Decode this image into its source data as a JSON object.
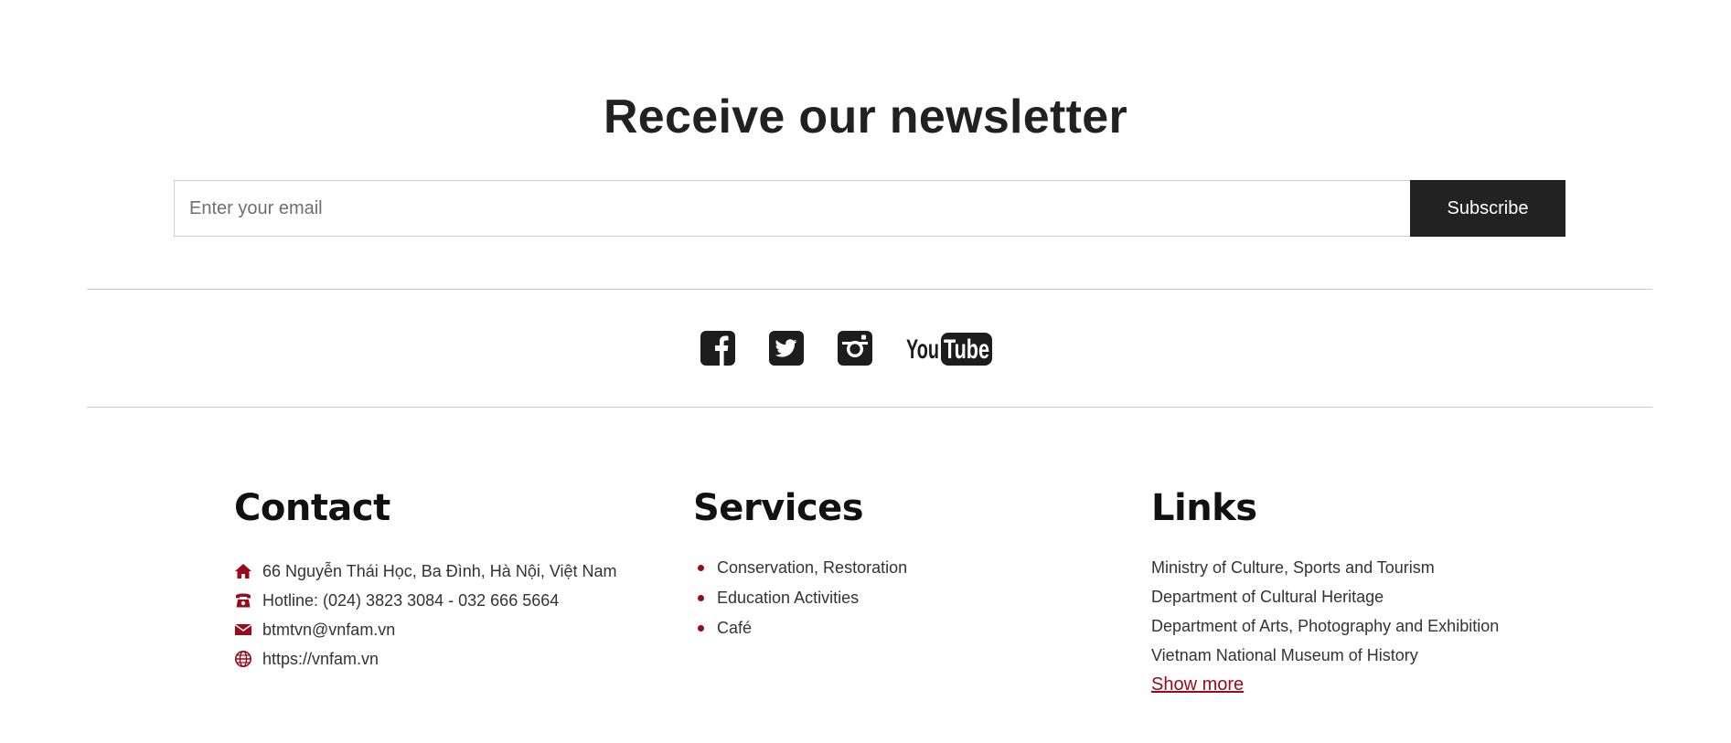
{
  "newsletter": {
    "title": "Receive our newsletter",
    "email_placeholder": "Enter your email",
    "subscribe_label": "Subscribe"
  },
  "social": {
    "items": [
      {
        "name": "facebook-icon"
      },
      {
        "name": "twitter-icon"
      },
      {
        "name": "instagram-icon"
      },
      {
        "name": "youtube-icon",
        "text_you": "You",
        "text_tube": "Tube"
      }
    ]
  },
  "contact": {
    "heading": "Contact",
    "items": [
      {
        "icon": "home-icon",
        "text": "66 Nguyễn Thái Học, Ba Đình, Hà Nội, Việt Nam"
      },
      {
        "icon": "phone-icon",
        "text": "Hotline: (024) 3823 3084 - 032 666 5664"
      },
      {
        "icon": "mail-icon",
        "text": "btmtvn@vnfam.vn"
      },
      {
        "icon": "globe-icon",
        "text": "https://vnfam.vn"
      }
    ]
  },
  "services": {
    "heading": "Services",
    "items": [
      "Conservation, Restoration",
      "Education Activities",
      "Café"
    ]
  },
  "links": {
    "heading": "Links",
    "items": [
      "Ministry of Culture, Sports and Tourism",
      "Department of Cultural Heritage",
      "Department of Arts, Photography and Exhibition",
      "Vietnam National Museum of History"
    ],
    "show_more": "Show more"
  },
  "colors": {
    "accent": "#9b0a1c",
    "dark": "#222222",
    "text": "#333333",
    "divider": "#c9c9c9"
  }
}
